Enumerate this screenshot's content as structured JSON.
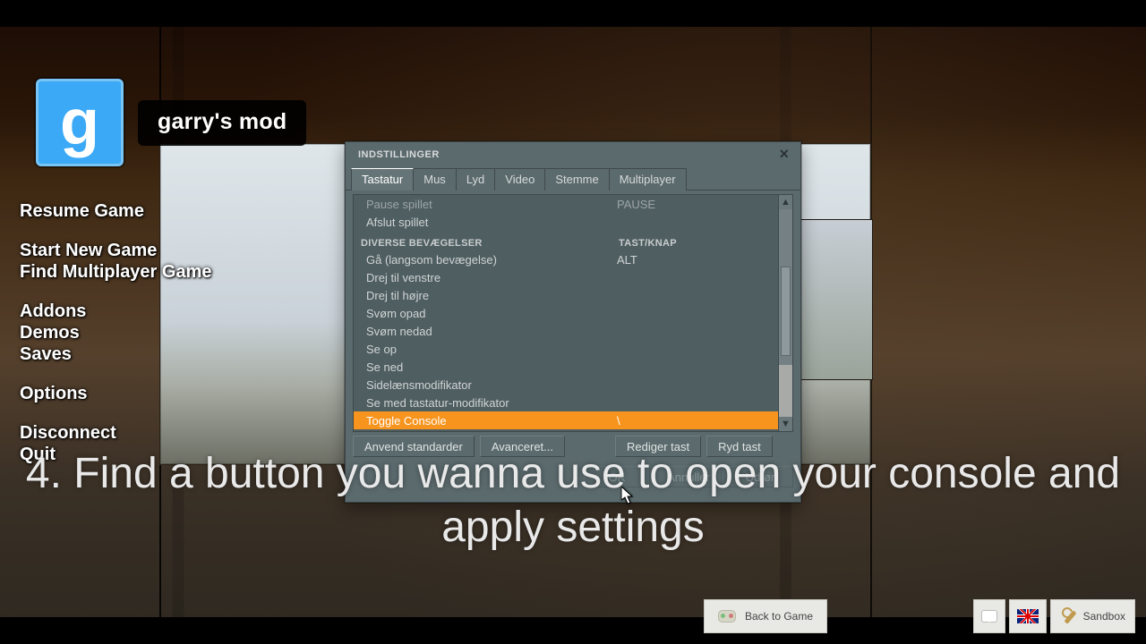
{
  "game_title": "garry's mod",
  "logo_letter": "g",
  "menu": {
    "resume": "Resume Game",
    "start": "Start New Game",
    "find": "Find Multiplayer Game",
    "addons": "Addons",
    "demos": "Demos",
    "saves": "Saves",
    "options": "Options",
    "disconnect": "Disconnect",
    "quit": "Quit"
  },
  "dialog": {
    "title": "INDSTILLINGER",
    "tabs": [
      "Tastatur",
      "Mus",
      "Lyd",
      "Video",
      "Stemme",
      "Multiplayer"
    ],
    "active_tab": 0,
    "category_header_col2": "TAST/KNAP",
    "top_rows": [
      {
        "label": "Pause spillet",
        "key": "PAUSE"
      },
      {
        "label": "Afslut spillet",
        "key": ""
      }
    ],
    "category": "DIVERSE BEVÆGELSER",
    "rows": [
      {
        "label": "Gå (langsom bevægelse)",
        "key": "ALT"
      },
      {
        "label": "Drej til venstre",
        "key": ""
      },
      {
        "label": "Drej til højre",
        "key": ""
      },
      {
        "label": "Svøm opad",
        "key": ""
      },
      {
        "label": "Svøm nedad",
        "key": ""
      },
      {
        "label": "Se op",
        "key": ""
      },
      {
        "label": "Se ned",
        "key": ""
      },
      {
        "label": "Sidelænsmodifikator",
        "key": ""
      },
      {
        "label": "Se med tastatur-modifikator",
        "key": ""
      }
    ],
    "selected": {
      "label": "Toggle Console",
      "key": "\\"
    },
    "buttons": {
      "defaults": "Anvend standarder",
      "advanced": "Avanceret...",
      "edit": "Rediger tast",
      "clear": "Ryd tast",
      "ok": "OK",
      "cancel": "Annuller",
      "apply": "Udfør"
    }
  },
  "instruction": "4. Find a button you wanna use to open your console and apply settings",
  "bottom": {
    "back": "Back to Game",
    "sandbox": "Sandbox"
  }
}
